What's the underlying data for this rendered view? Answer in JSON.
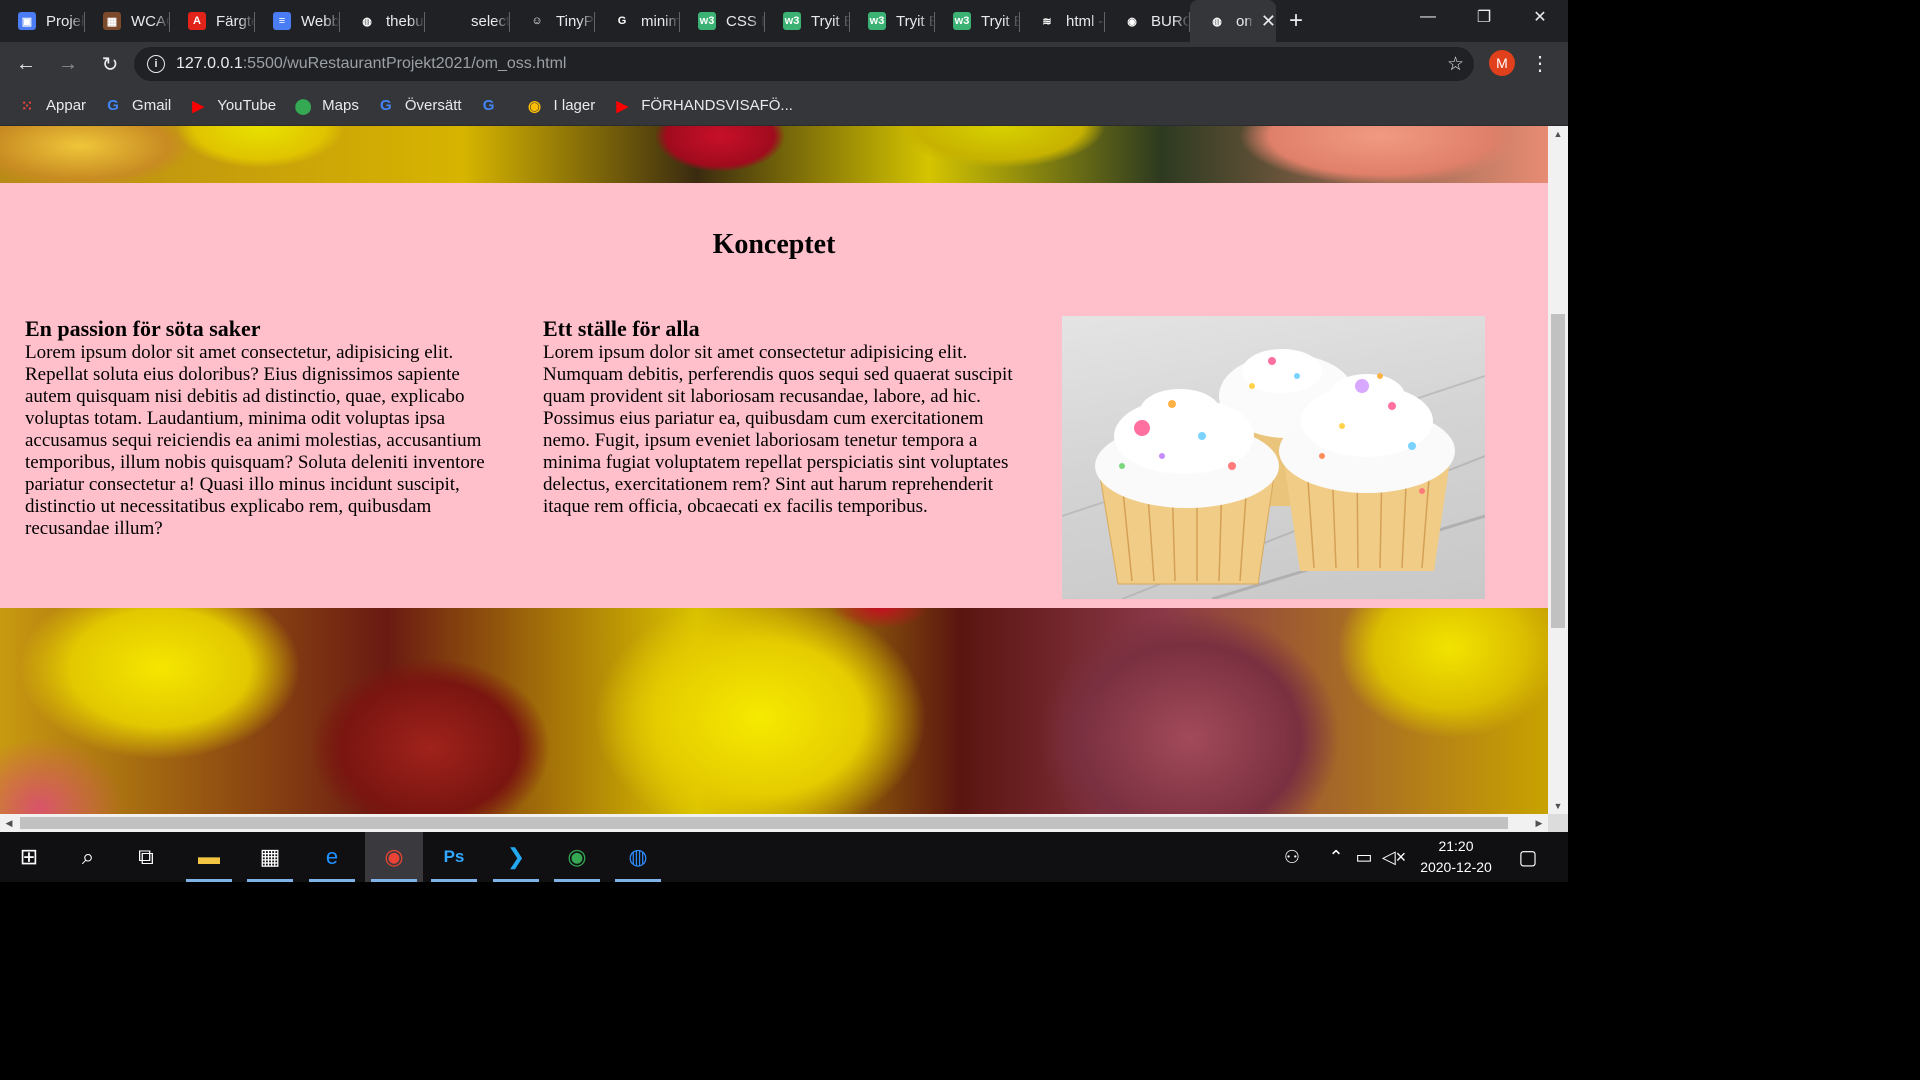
{
  "browser": {
    "tabs": [
      {
        "title": "Projekt",
        "color": "#4a7cf4",
        "glyph": "▣"
      },
      {
        "title": "WCAG",
        "color": "#7a4a2a",
        "glyph": "▦"
      },
      {
        "title": "Färgtema",
        "color": "#e2231a",
        "glyph": "A"
      },
      {
        "title": "Webbdesign",
        "color": "#4a7cf4",
        "glyph": "≡"
      },
      {
        "title": "thebuttonmaker",
        "color": "#202124",
        "glyph": "◍"
      },
      {
        "title": "select",
        "color": "#202124",
        "glyph": ""
      },
      {
        "title": "TinyPNG",
        "color": "#202124",
        "glyph": "☺"
      },
      {
        "title": "minimize",
        "color": "#202124",
        "glyph": "G"
      },
      {
        "title": "CSS Inspector",
        "color": "#3bb273",
        "glyph": "w3"
      },
      {
        "title": "Tryit Editor",
        "color": "#3bb273",
        "glyph": "w3"
      },
      {
        "title": "Tryit Editor",
        "color": "#3bb273",
        "glyph": "w3"
      },
      {
        "title": "Tryit Editor",
        "color": "#3bb273",
        "glyph": "w3"
      },
      {
        "title": "html - Stack Overflow",
        "color": "#202124",
        "glyph": "≋"
      },
      {
        "title": "BURGER KING",
        "color": "#202124",
        "glyph": "◉"
      }
    ],
    "active_tab": {
      "title": "om oss",
      "glyph": "◍"
    },
    "new_tab_label": "+",
    "window_controls": {
      "minimize": "—",
      "restore": "❐",
      "close": "✕"
    },
    "nav": {
      "back": "←",
      "forward": "→",
      "reload": "↻"
    },
    "url_host": "127.0.0.1",
    "url_rest": ":5500/wuRestaurantProjekt2021/om_oss.html",
    "info_glyph": "i",
    "star_glyph": "☆",
    "profile_initial": "M",
    "menu_glyph": "⋮",
    "bookmarks": [
      {
        "label": "Appar",
        "icon": "apps-grid-icon",
        "glyph": "⁙",
        "color": "#ea4335"
      },
      {
        "label": "Gmail",
        "icon": "google-icon",
        "glyph": "G",
        "color": "#4285f4"
      },
      {
        "label": "YouTube",
        "icon": "youtube-icon",
        "glyph": "▶",
        "color": "#ff0000"
      },
      {
        "label": "Maps",
        "icon": "maps-pin-icon",
        "glyph": "⬤",
        "color": "#34a853"
      },
      {
        "label": "Översätt",
        "icon": "translate-icon",
        "glyph": "G",
        "color": "#4285f4"
      },
      {
        "label": "",
        "icon": "google-icon",
        "glyph": "G",
        "color": "#4285f4"
      },
      {
        "label": "I lager",
        "icon": "chrome-icon",
        "glyph": "◉",
        "color": "#fbbc04"
      },
      {
        "label": "FÖRHANDSVISAFÖ...",
        "icon": "youtube-icon",
        "glyph": "▶",
        "color": "#ff0000"
      }
    ]
  },
  "page": {
    "section_title": "Konceptet",
    "col1": {
      "heading": "En passion för söta saker",
      "body": "Lorem ipsum dolor sit amet consectetur, adipisicing elit. Repellat soluta eius doloribus? Eius dignissimos sapiente autem quisquam nisi debitis ad distinctio, quae, explicabo voluptas totam. Laudantium, minima odit voluptas ipsa accusamus sequi reiciendis ea animi molestias, accusantium temporibus, illum nobis quisquam? Soluta deleniti inventore pariatur consectetur a! Quasi illo minus incidunt suscipit, distinctio ut necessitatibus explicabo rem, quibusdam recusandae illum?"
    },
    "col2": {
      "heading": "Ett ställe för alla",
      "body": "Lorem ipsum dolor sit amet consectetur adipisicing elit. Numquam debitis, perferendis quos sequi sed quaerat suscipit quam provident sit laboriosam recusandae, labore, ad hic. Possimus eius pariatur ea, quibusdam cum exercitationem nemo. Fugit, ipsum eveniet laboriosam tenetur tempora a minima fugiat voluptatem repellat perspiciatis sint voluptates delectus, exercitationem rem? Sint aut harum reprehenderit itaque rem officia, obcaecati ex facilis temporibus."
    }
  },
  "scroll": {
    "up": "▲",
    "down": "▼",
    "left": "◀",
    "right": "▶"
  },
  "taskbar": {
    "time": "21:20",
    "date": "2020-12-20",
    "apps": [
      {
        "name": "windows-start-icon",
        "glyph": "⊞",
        "color": "#ffffff"
      },
      {
        "name": "search-icon",
        "glyph": "⌕",
        "color": "#ffffff"
      },
      {
        "name": "task-view-icon",
        "glyph": "⧉",
        "color": "#ffffff"
      },
      {
        "name": "file-explorer-icon",
        "glyph": "▬",
        "color": "#f4c542"
      },
      {
        "name": "microsoft-store-icon",
        "glyph": "▦",
        "color": "#ffffff"
      },
      {
        "name": "edge-icon",
        "glyph": "e",
        "color": "#1e90ff"
      },
      {
        "name": "chrome-icon",
        "glyph": "◉",
        "color": "#ea4335"
      },
      {
        "name": "photoshop-icon",
        "glyph": "Ps",
        "color": "#31a8ff"
      },
      {
        "name": "vscode-icon",
        "glyph": "❯",
        "color": "#23a9f2"
      },
      {
        "name": "chrome-profile-icon",
        "glyph": "◉",
        "color": "#34a853"
      },
      {
        "name": "firefox-icon",
        "glyph": "◍",
        "color": "#2f8cff"
      }
    ],
    "tray": [
      {
        "name": "people-icon",
        "glyph": "⚇"
      },
      {
        "name": "tray-chevron-icon",
        "glyph": "⌃"
      },
      {
        "name": "battery-icon",
        "glyph": "▭"
      },
      {
        "name": "volume-muted-icon",
        "glyph": "◁×"
      }
    ],
    "notification_glyph": "▢"
  }
}
